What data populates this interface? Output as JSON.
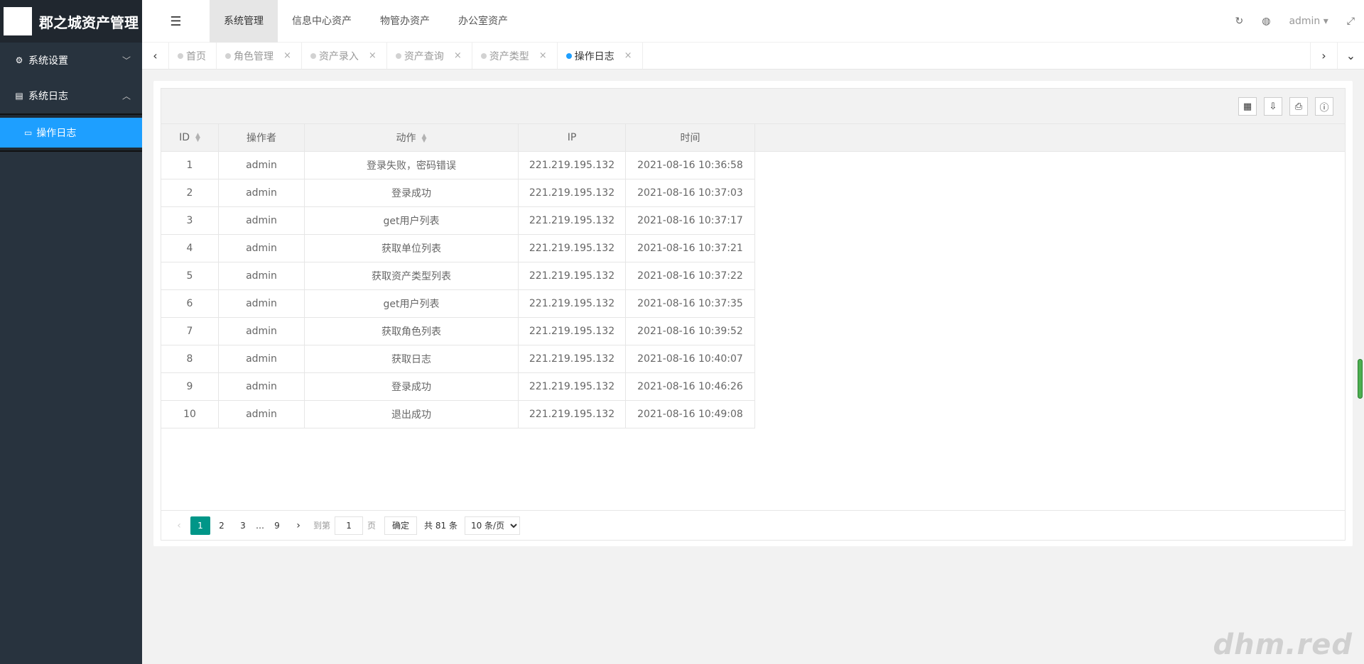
{
  "app": {
    "title": "郡之城资产管理"
  },
  "sidebar": {
    "items": [
      {
        "label": "系统设置",
        "icon": "gears-icon",
        "expanded": false
      },
      {
        "label": "系统日志",
        "icon": "file-icon",
        "expanded": true,
        "children": [
          {
            "label": "操作日志",
            "icon": "file-text-icon",
            "active": true
          }
        ]
      }
    ]
  },
  "header": {
    "menu": [
      {
        "label": "系统管理",
        "active": true
      },
      {
        "label": "信息中心资产"
      },
      {
        "label": "物管办资产"
      },
      {
        "label": "办公室资产"
      }
    ],
    "user": "admin"
  },
  "tabs": [
    {
      "label": "首页",
      "closable": false,
      "active": false
    },
    {
      "label": "角色管理",
      "closable": true,
      "active": false
    },
    {
      "label": "资产录入",
      "closable": true,
      "active": false
    },
    {
      "label": "资产查询",
      "closable": true,
      "active": false
    },
    {
      "label": "资产类型",
      "closable": true,
      "active": false
    },
    {
      "label": "操作日志",
      "closable": true,
      "active": true
    }
  ],
  "table": {
    "columns": [
      "ID",
      "操作者",
      "动作",
      "IP",
      "时间"
    ],
    "rows": [
      [
        "1",
        "admin",
        "登录失败，密码错误",
        "221.219.195.132",
        "2021-08-16 10:36:58"
      ],
      [
        "2",
        "admin",
        "登录成功",
        "221.219.195.132",
        "2021-08-16 10:37:03"
      ],
      [
        "3",
        "admin",
        "get用户列表",
        "221.219.195.132",
        "2021-08-16 10:37:17"
      ],
      [
        "4",
        "admin",
        "获取单位列表",
        "221.219.195.132",
        "2021-08-16 10:37:21"
      ],
      [
        "5",
        "admin",
        "获取资产类型列表",
        "221.219.195.132",
        "2021-08-16 10:37:22"
      ],
      [
        "6",
        "admin",
        "get用户列表",
        "221.219.195.132",
        "2021-08-16 10:37:35"
      ],
      [
        "7",
        "admin",
        "获取角色列表",
        "221.219.195.132",
        "2021-08-16 10:39:52"
      ],
      [
        "8",
        "admin",
        "获取日志",
        "221.219.195.132",
        "2021-08-16 10:40:07"
      ],
      [
        "9",
        "admin",
        "登录成功",
        "221.219.195.132",
        "2021-08-16 10:46:26"
      ],
      [
        "10",
        "admin",
        "退出成功",
        "221.219.195.132",
        "2021-08-16 10:49:08"
      ]
    ]
  },
  "pager": {
    "pages": [
      "1",
      "2",
      "3",
      "…",
      "9"
    ],
    "current": "1",
    "goto_label": "到第",
    "goto_value": "1",
    "page_label": "页",
    "confirm": "确定",
    "total": "共 81 条",
    "page_size": "10 条/页"
  },
  "watermark": "dhm.red"
}
